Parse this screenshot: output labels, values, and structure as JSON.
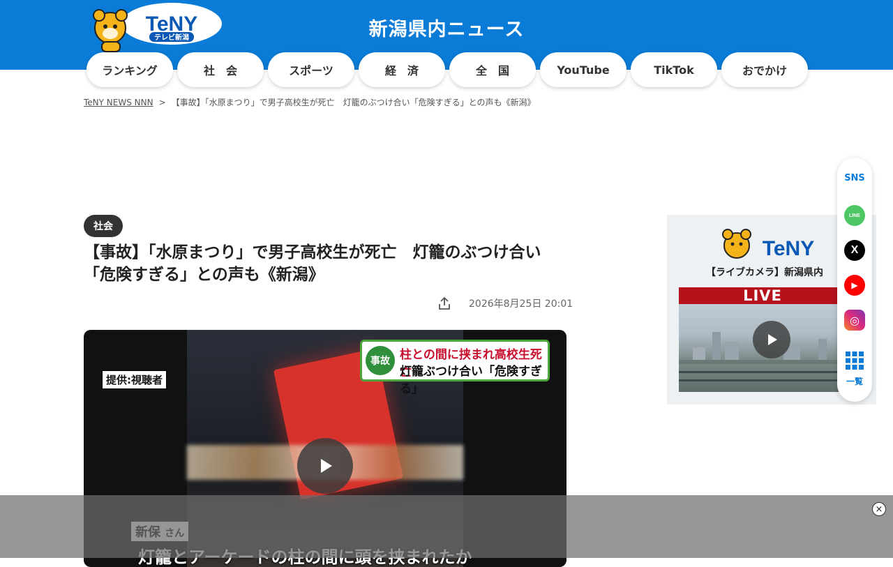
{
  "header": {
    "site_title": "新潟県内ニュース",
    "logo_text": "TeNY",
    "logo_sub": "テレビ新潟",
    "color": "#0a7bd6"
  },
  "nav": [
    {
      "label": "ランキング"
    },
    {
      "label": "社　会"
    },
    {
      "label": "スポーツ"
    },
    {
      "label": "経　済"
    },
    {
      "label": "全　国"
    },
    {
      "label": "YouTube"
    },
    {
      "label": "TikTok"
    },
    {
      "label": "おでかけ"
    }
  ],
  "breadcrumb": {
    "home": "TeNY NEWS NNN",
    "separator": ">",
    "current": "【事故】「水原まつり」で男子高校生が死亡　灯籠のぶつけ合い「危険すぎる」との声も《新潟》"
  },
  "article": {
    "category": "社会",
    "headline": "【事故】「水原まつり」で男子高校生が死亡　灯籠のぶつけ合い\n「危険すぎる」との声も《新潟》",
    "date": "2026年8月25日 20:01"
  },
  "video": {
    "provider": "提供:視聴者",
    "caption_tag": "事故",
    "caption_line1": "柱との間に挟まれ高校生死亡",
    "caption_line2": "灯籠ぶつけ合い「危険すぎる」",
    "speaker_name": "新保",
    "speaker_suffix": "さん",
    "subtitle": "灯籠とアーケードの柱の間に頭を挟まれたか"
  },
  "side": {
    "logo_text": "TeNY",
    "title": "【ライブカメラ】新潟県内",
    "live_label": "LIVE"
  },
  "sns": {
    "label": "SNS",
    "list_label": "一覧",
    "icons": [
      {
        "name": "line",
        "text": "LINE",
        "color": "#4cc764"
      },
      {
        "name": "x",
        "text": "X",
        "color": "#000000"
      },
      {
        "name": "youtube",
        "text": "▶",
        "color": "#ff0000"
      },
      {
        "name": "instagram",
        "text": "◎",
        "color": "#d6249f"
      }
    ]
  },
  "ad": {
    "close_label": "×"
  }
}
